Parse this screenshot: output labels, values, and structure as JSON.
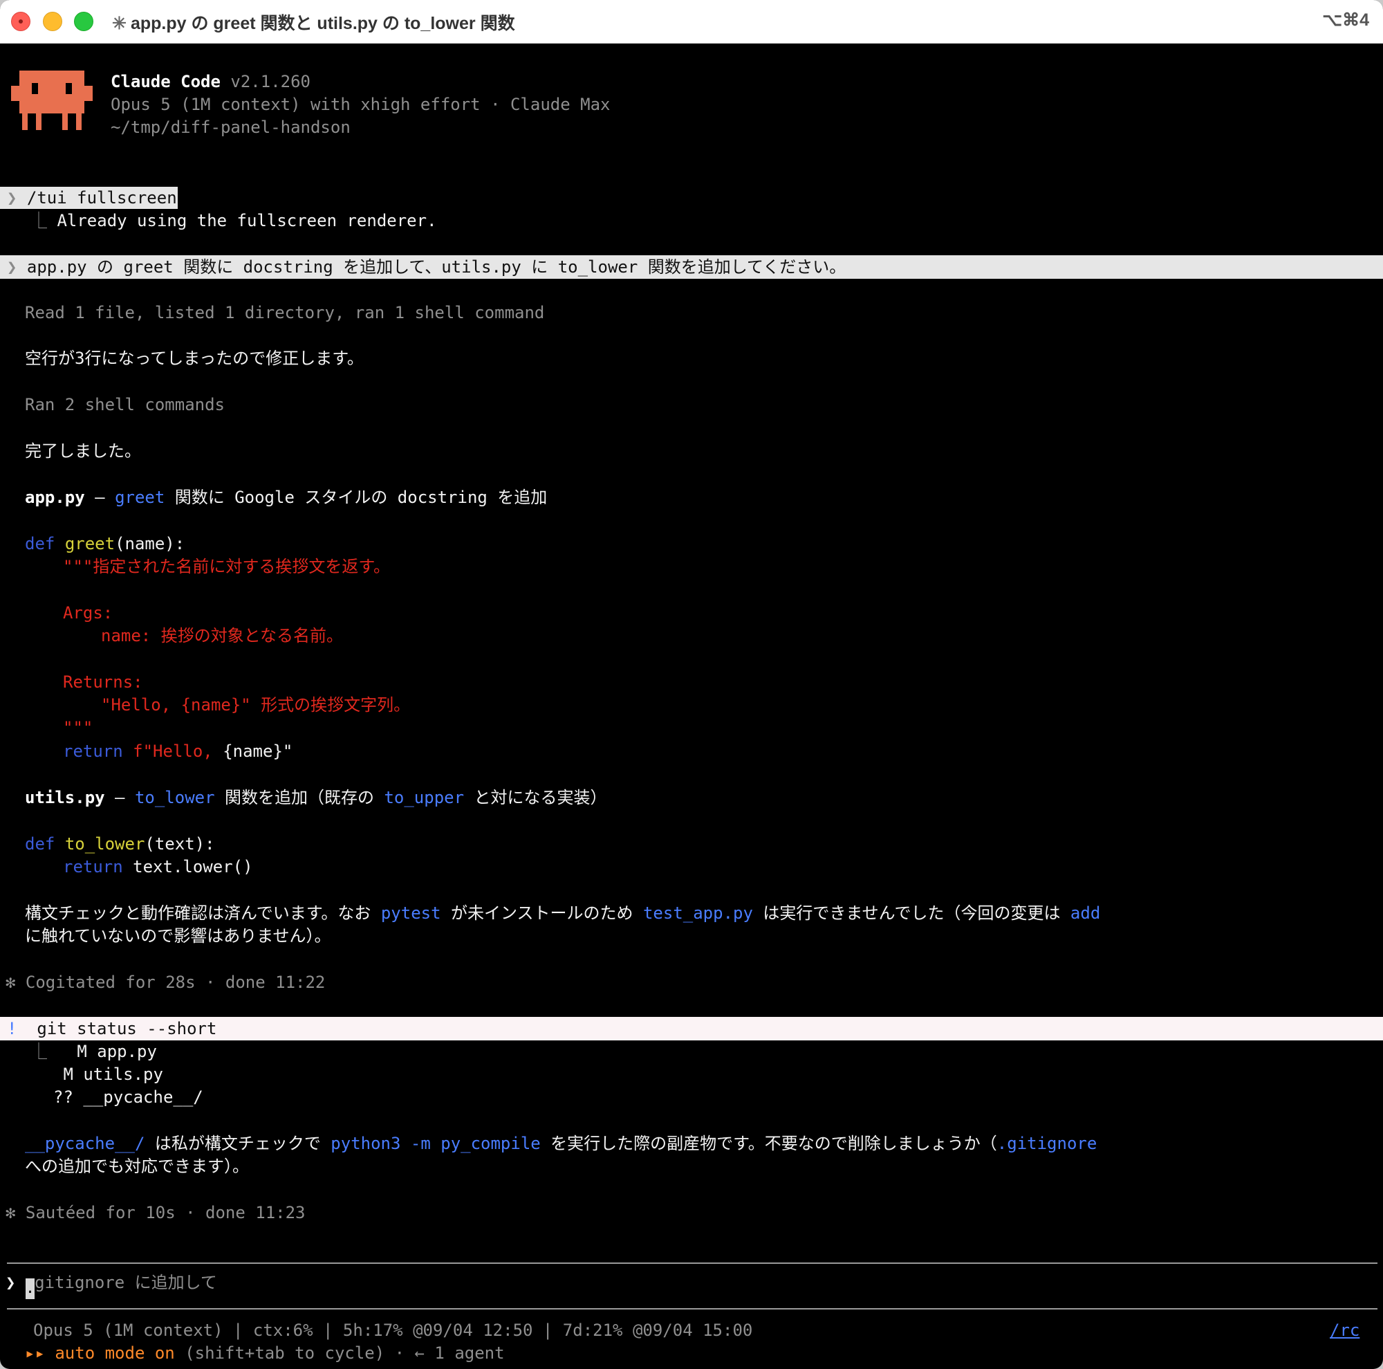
{
  "window": {
    "title": "app.py の greet 関数と utils.py の to_lower 関数",
    "spinner": "✳",
    "shortcut": "⌥⌘4"
  },
  "header": {
    "app_name": "Claude Code",
    "version": "v2.1.260",
    "model_line": "Opus 5 (1M context) with xhigh effort · Claude Max",
    "cwd": "~/tmp/diff-panel-handson"
  },
  "history": {
    "cmd1": {
      "prompt_glyph": "❯",
      "text": "/tui fullscreen",
      "result": "Already using the fullscreen renderer.",
      "branch": "⎿"
    },
    "user_msg": {
      "prompt_glyph": "❯",
      "text": "app.py の greet 関数に docstring を追加して、utils.py に to_lower 関数を追加してください。"
    },
    "tool_summary1": "Read 1 file, listed 1 directory, ran 1 shell command",
    "msg1": "空行が3行になってしまったので修正します。",
    "tool_summary2": "Ran 2 shell commands",
    "msg2": "完了しました。",
    "app_heading": {
      "file": "app.py",
      "dash": " – ",
      "fn": "greet",
      "rest": " 関数に Google スタイルの docstring を追加"
    },
    "code1": {
      "def": "def",
      "name": "greet",
      "sig": "(name):",
      "doc_open": "\"\"\"指定された名前に対する挨拶文を返す。",
      "args": "Args:",
      "args_item": "name: 挨拶の対象となる名前。",
      "returns": "Returns:",
      "returns_item": "\"Hello, {name}\" 形式の挨拶文字列。",
      "doc_close": "\"\"\"",
      "return_kw": "return",
      "return_str": "f\"Hello, ",
      "return_rest": "{name}\""
    },
    "utils_heading": {
      "file": "utils.py",
      "dash": " – ",
      "fn": "to_lower",
      "mid": " 関数を追加（既存の ",
      "fn2": "to_upper",
      "rest": " と対になる実装）"
    },
    "code2": {
      "def": "def",
      "name": "to_lower",
      "sig": "(text):",
      "return_kw": "return",
      "return_rest": " text.lower()"
    },
    "msg3": {
      "a": "構文チェックと動作確認は済んでいます。なお ",
      "b": "pytest",
      "c": " が未インストールのため ",
      "d": "test_app.py",
      "e": " は実行できませんでした（今回の変更は ",
      "f": "add",
      "line2": "に触れていないので影響はありません）。"
    },
    "status1": {
      "glyph": "✻",
      "text": "Cogitated for 28s · done 11:22"
    },
    "bash": {
      "glyph": "!",
      "command": "git status --short",
      "branch": "⎿",
      "out": [
        " M app.py",
        " M utils.py",
        "?? __pycache__/"
      ]
    },
    "msg4": {
      "a": "__pycache__/",
      "b": " は私が構文チェックで ",
      "c": "python3 -m py_compile",
      "d": " を実行した際の副産物です。不要なので削除しましょうか（",
      "e": ".gitignore",
      "line2": "への追加でも対応できます）。"
    },
    "status2": {
      "glyph": "✻",
      "text": "Sautéed for 10s · done 11:23"
    }
  },
  "input": {
    "prompt_glyph": "❯",
    "placeholder_first": ".",
    "placeholder_rest": "gitignore に追加して"
  },
  "footer": {
    "status_line": "Opus 5 (1M context) | ctx:6% | 5h:17% @09/04 12:50 | 7d:21% @09/04 15:00",
    "rc_link": "/rc",
    "mode_glyph": "▸▸",
    "mode_label": "auto mode on",
    "mode_hint": " (shift+tab to cycle) · ← 1 agent"
  },
  "colors": {
    "mascot": "#e8704f",
    "keyword": "#3b5bd9",
    "function": "#d7d23a",
    "string": "#e0281e",
    "accent_blue": "#4a7dff",
    "auto_mode": "#ff8a2a"
  }
}
